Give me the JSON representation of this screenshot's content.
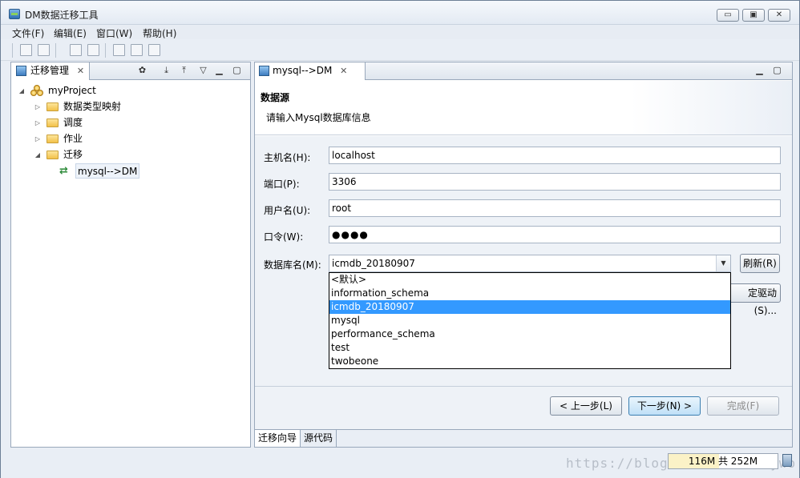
{
  "window": {
    "title": "DM数据迁移工具",
    "minimize_symbol": "▭",
    "maximize_symbol": "▣",
    "close_symbol": "✕"
  },
  "menu": [
    "文件(F)",
    "编辑(E)",
    "窗口(W)",
    "帮助(H)"
  ],
  "left_view": {
    "tab_label": "迁移管理",
    "close_symbol": "✕",
    "tree": {
      "project": "myProject",
      "children": [
        "数据类型映射",
        "调度",
        "作业",
        "迁移"
      ],
      "migration_item": "mysql-->DM"
    }
  },
  "editor": {
    "tab_label": "mysql-->DM",
    "close_symbol": "✕",
    "header_title": "数据源",
    "header_description": "请输入Mysql数据库信息",
    "fields": {
      "host_label": "主机名(H):",
      "host_value": "localhost",
      "port_label": "端口(P):",
      "port_value": "3306",
      "user_label": "用户名(U):",
      "user_value": "root",
      "password_label": "口令(W):",
      "password_value": "●●●●",
      "database_label": "数据库名(M):",
      "database_value": "icmdb_20180907"
    },
    "refresh_button": "刷新(R)",
    "driver_button_partial": "定驱动(S)...",
    "dropdown_options": [
      "<默认>",
      "information_schema",
      "icmdb_20180907",
      "mysql",
      "performance_schema",
      "test",
      "twobeone"
    ],
    "dropdown_selected_index": 2,
    "buttons": {
      "back": "< 上一步(L)",
      "next": "下一步(N) >",
      "finish": "完成(F)"
    },
    "bottom_tabs": [
      "迁移向导",
      "源代码"
    ]
  },
  "status": {
    "watermark": "https://blog.csdn.net/boywo",
    "heap_text": "116M 共 252M",
    "heap_used_fraction": 0.46
  }
}
